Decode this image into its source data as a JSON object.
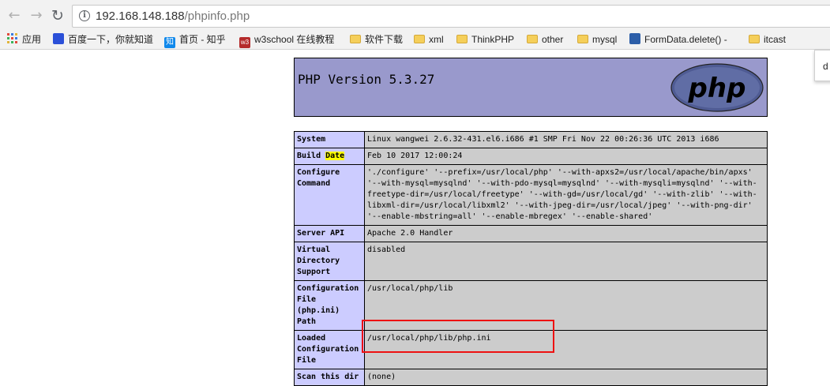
{
  "browser": {
    "url_host": "192.168.148.188",
    "url_path": "/phpinfo.php"
  },
  "bookmarks": [
    {
      "label": "应用",
      "icon": "apps-grid-icon"
    },
    {
      "label": "百度一下，你就知道",
      "icon": "baidu-paw-icon"
    },
    {
      "label": "首页 - 知乎",
      "icon": "zhihu-icon"
    },
    {
      "label": "w3school 在线教程",
      "icon": "w3school-icon"
    },
    {
      "label": "软件下载",
      "icon": "folder-icon"
    },
    {
      "label": "xml",
      "icon": "folder-icon"
    },
    {
      "label": "ThinkPHP",
      "icon": "folder-icon"
    },
    {
      "label": "other",
      "icon": "folder-icon"
    },
    {
      "label": "mysql",
      "icon": "folder-icon"
    },
    {
      "label": "FormData.delete() -",
      "icon": "mdn-icon"
    },
    {
      "label": "itcast",
      "icon": "folder-icon"
    }
  ],
  "popup": {
    "text": "d"
  },
  "phpinfo": {
    "version_title": "PHP Version 5.3.27",
    "logo_text": "php",
    "rows": [
      {
        "key": "System",
        "value": "Linux wangwei 2.6.32-431.el6.i686 #1 SMP Fri Nov 22 00:26:36 UTC 2013 i686"
      },
      {
        "key_part1": "Build ",
        "key_part2": "Date",
        "value": "Feb 10 2017 12:00:24"
      },
      {
        "key": "Configure Command",
        "value": "'./configure' '--prefix=/usr/local/php' '--with-apxs2=/usr/local/apache/bin/apxs' '--with-mysql=mysqlnd' '--with-pdo-mysql=mysqlnd' '--with-mysqli=mysqlnd' '--with-freetype-dir=/usr/local/freetype' '--with-gd=/usr/local/gd' '--with-zlib' '--with-libxml-dir=/usr/local/libxml2' '--with-jpeg-dir=/usr/local/jpeg' '--with-png-dir' '--enable-mbstring=all' '--enable-mbregex' '--enable-shared'"
      },
      {
        "key": "Server API",
        "value": "Apache 2.0 Handler"
      },
      {
        "key": "Virtual Directory Support",
        "value": "disabled"
      },
      {
        "key": "Configuration File (php.ini) Path",
        "value": "/usr/local/php/lib"
      },
      {
        "key": "Loaded Configuration File",
        "value": "/usr/local/php/lib/php.ini"
      },
      {
        "key": "Scan this dir",
        "value": "(none)"
      }
    ]
  }
}
